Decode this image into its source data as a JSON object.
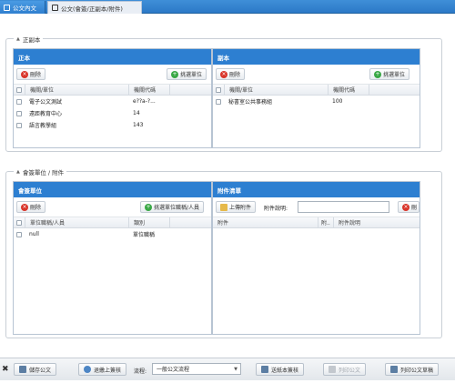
{
  "tabs": [
    {
      "label": "公文內文"
    },
    {
      "label": "公文(會簽/正副本/附件)"
    }
  ],
  "section1": {
    "legend": "正副本",
    "main_panel": {
      "title": "正本",
      "delete_label": "刪除",
      "select_label": "挑選單位",
      "columns": [
        "機關/單位",
        "機關代碼"
      ],
      "rows": [
        {
          "name": "電子公文測試",
          "code": "e??a-?..."
        },
        {
          "name": "遠距教育中心",
          "code": "14"
        },
        {
          "name": "語言教學組",
          "code": "143"
        }
      ]
    },
    "copy_panel": {
      "title": "副本",
      "delete_label": "刪除",
      "select_label": "挑選單位",
      "columns": [
        "機關/單位",
        "機關代碼"
      ],
      "rows": [
        {
          "name": "秘書室公共事務組",
          "code": "100"
        }
      ]
    }
  },
  "section2": {
    "legend": "會簽單位 / 附件",
    "countersign_panel": {
      "title": "會簽單位",
      "delete_label": "刪除",
      "select_label": "挑選單位職稱/人員",
      "columns": [
        "單位職稱/人員",
        "類別"
      ],
      "rows": [
        {
          "name": "null",
          "type": "單位職稱"
        }
      ]
    },
    "attachment_panel": {
      "title": "附件清單",
      "upload_label": "上傳附件",
      "desc_label": "附件說明:",
      "desc_value": "",
      "delete_label": "刪",
      "columns": [
        "附件",
        "附..",
        "附件說明"
      ]
    }
  },
  "bottom": {
    "save_label": "儲存公文",
    "return_label": "退繳上簽核",
    "flow_label": "流程:",
    "flow_value": "一般公文流程",
    "send_label": "送紙本簽核",
    "print_doc_label": "列印公文",
    "print_sheet_label": "列印公文草稿"
  },
  "colors": {
    "header_blue": "#2d7fd1",
    "delete_red": "#d9352a",
    "add_green": "#39a845"
  }
}
